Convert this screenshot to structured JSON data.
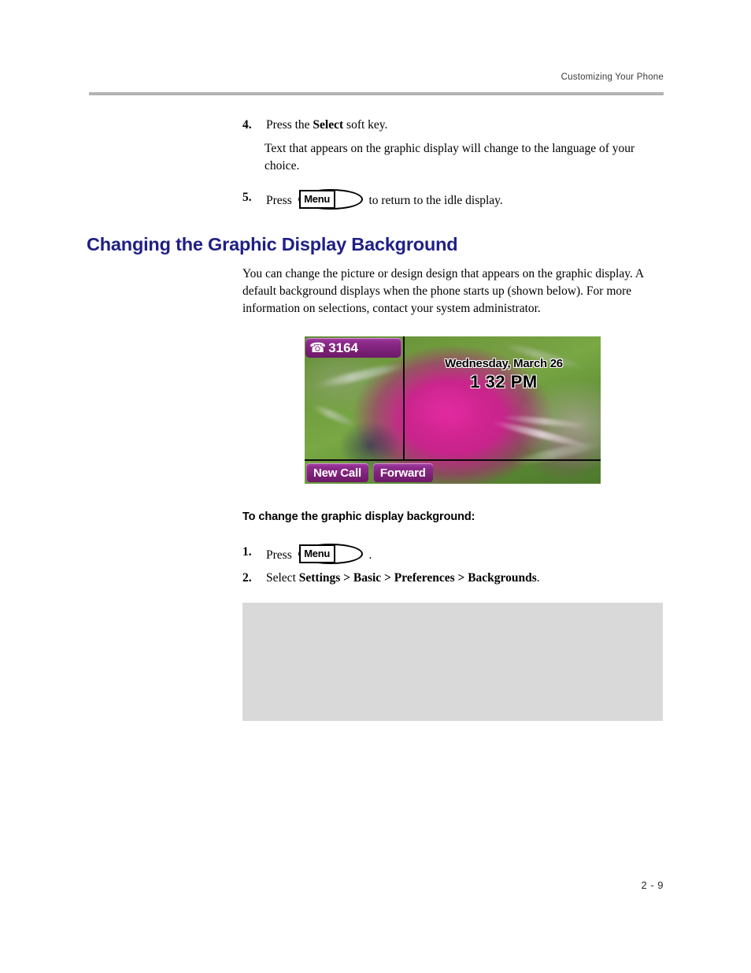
{
  "header": {
    "running_head": "Customizing Your Phone"
  },
  "steps_top": [
    {
      "num": "4.",
      "text_before": "Press the ",
      "bold": "Select",
      "text_after": " soft key."
    },
    {
      "num": "5.",
      "text_before": "Press ",
      "key_label": "Menu",
      "text_after": " to return to the idle display."
    }
  ],
  "notes": {
    "step4_note": "Text that appears on the graphic display will change to the language of your choice."
  },
  "section": {
    "heading": "Changing the Graphic Display Background",
    "paragraph": "You can change the picture or design design that appears on the graphic display. A default background displays when the phone starts up (shown below). For more information on selections, contact your system administrator.",
    "subheading": "To change the graphic display background:"
  },
  "phone_screen": {
    "line_key": {
      "icon": "telephone-handset-icon",
      "glyph": "☎",
      "extension": "3164"
    },
    "date": "Wednesday, March 26",
    "time": "1 32 PM",
    "soft_keys": [
      {
        "label": "New Call"
      },
      {
        "label": "Forward"
      }
    ],
    "colors": {
      "key_purple": "#7d2177",
      "key_purple_highlight": "#a845a8",
      "key_text": "#ffffff",
      "divider": "#0a0a0a"
    }
  },
  "steps_bottom": [
    {
      "num": "1.",
      "text_before": "Press ",
      "key_label": "Menu",
      "text_after": " ."
    },
    {
      "num": "2.",
      "text_before": "Select ",
      "bold": "Settings > Basic > Preferences > Backgrounds",
      "text_after": "."
    }
  ],
  "footer": {
    "page_number": "2 - 9"
  },
  "theme": {
    "heading_blue": "#1f1f85",
    "rule_gray": "#b4b4b4",
    "placeholder_gray": "#d9d9d9"
  }
}
